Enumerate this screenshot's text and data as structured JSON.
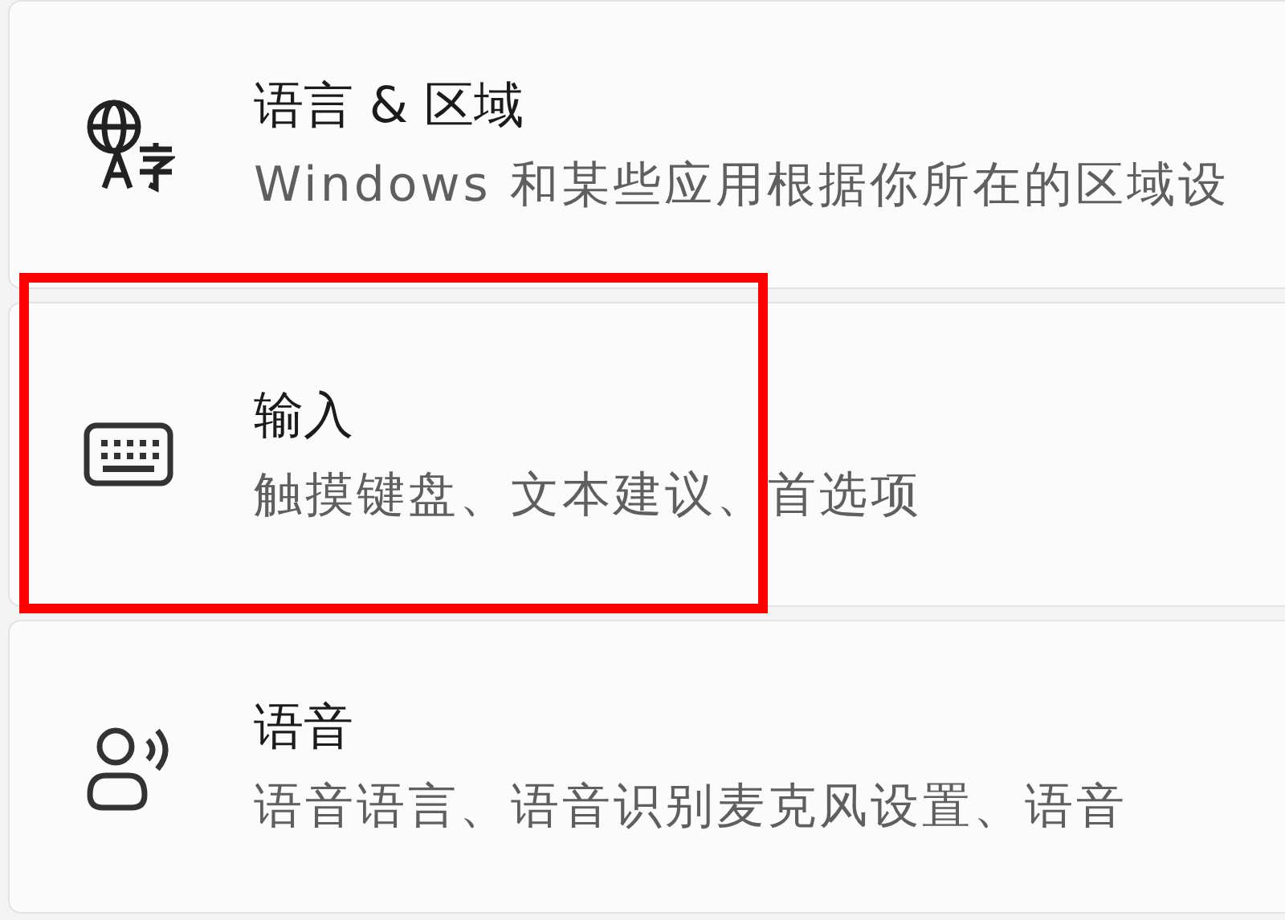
{
  "items": [
    {
      "kind": "language",
      "title": "语言 & 区域",
      "subtitle": "Windows 和某些应用根据你所在的区域设",
      "highlighted": false
    },
    {
      "kind": "keyboard",
      "title": "输入",
      "subtitle": "触摸键盘、文本建议、首选项",
      "highlighted": true
    },
    {
      "kind": "speech",
      "title": "语音",
      "subtitle": "语音语言、语音识别麦克风设置、语音",
      "highlighted": false
    }
  ]
}
